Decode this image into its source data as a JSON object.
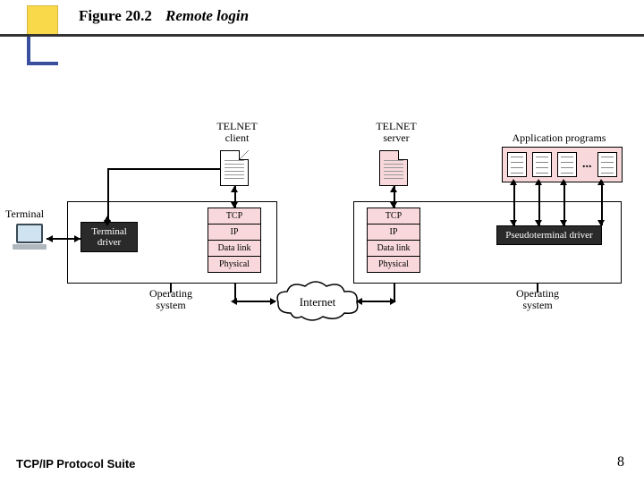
{
  "header": {
    "figure_number": "Figure 20.2",
    "figure_title": "Remote login"
  },
  "footer": {
    "book": "TCP/IP Protocol Suite",
    "page": "8"
  },
  "labels": {
    "telnet_client": "TELNET\nclient",
    "telnet_server": "TELNET\nserver",
    "app_programs": "Application programs",
    "terminal": "Terminal",
    "terminal_driver": "Terminal\ndriver",
    "pseudo_driver": "Pseudoterminal\ndriver",
    "os_left": "Operating\nsystem",
    "os_right": "Operating\nsystem",
    "internet": "Internet",
    "dots": "..."
  },
  "stack_layers": [
    "TCP",
    "IP",
    "Data link",
    "Physical"
  ]
}
